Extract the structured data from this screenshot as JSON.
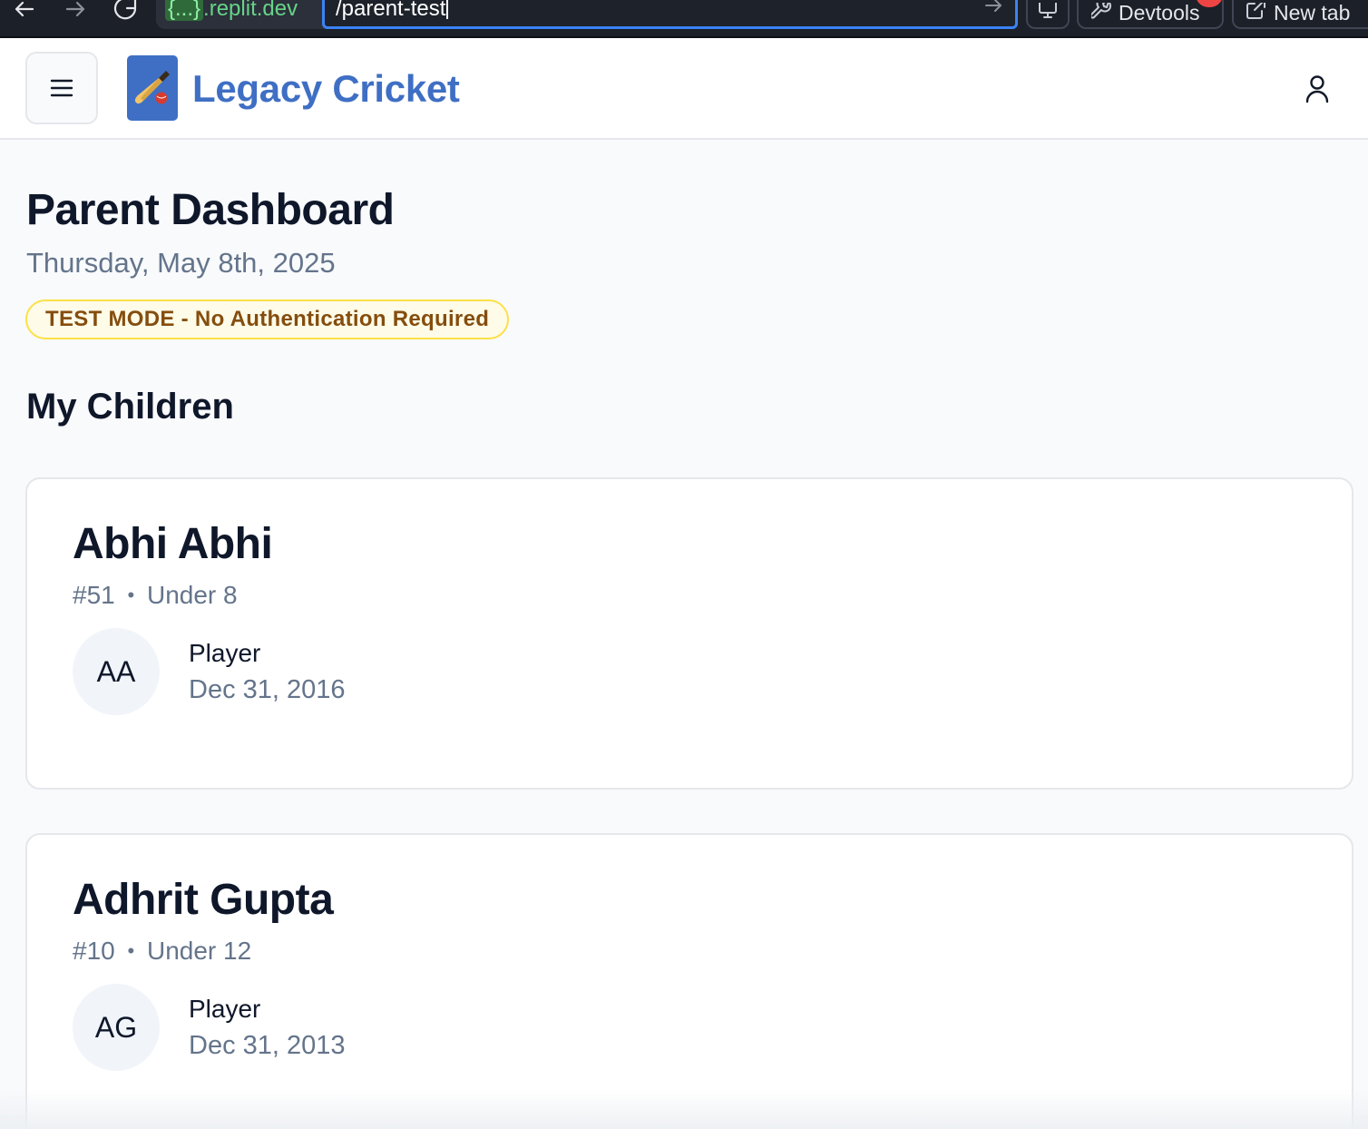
{
  "browser": {
    "url_domain_prefix": "{...}",
    "url_domain_suffix": ".replit.dev",
    "url_path": "/parent-test",
    "devtools_label": "Devtools",
    "new_tab_label": "New tab"
  },
  "header": {
    "brand": "Legacy Cricket"
  },
  "page": {
    "title": "Parent Dashboard",
    "date": "Thursday, May 8th, 2025",
    "test_mode_badge": "TEST MODE - No Authentication Required",
    "section_title": "My Children"
  },
  "children": [
    {
      "name": "Abhi Abhi",
      "number": "#51",
      "separator": "•",
      "age_group": "Under 8",
      "initials": "AA",
      "role": "Player",
      "dob": "Dec 31, 2016"
    },
    {
      "name": "Adhrit Gupta",
      "number": "#10",
      "separator": "•",
      "age_group": "Under 12",
      "initials": "AG",
      "role": "Player",
      "dob": "Dec 31, 2013"
    }
  ],
  "colors": {
    "brand": "#3f6fc4",
    "badge_bg": "#fefce8",
    "badge_border": "#fde047",
    "badge_text": "#854d0e",
    "muted_text": "#64748b"
  }
}
